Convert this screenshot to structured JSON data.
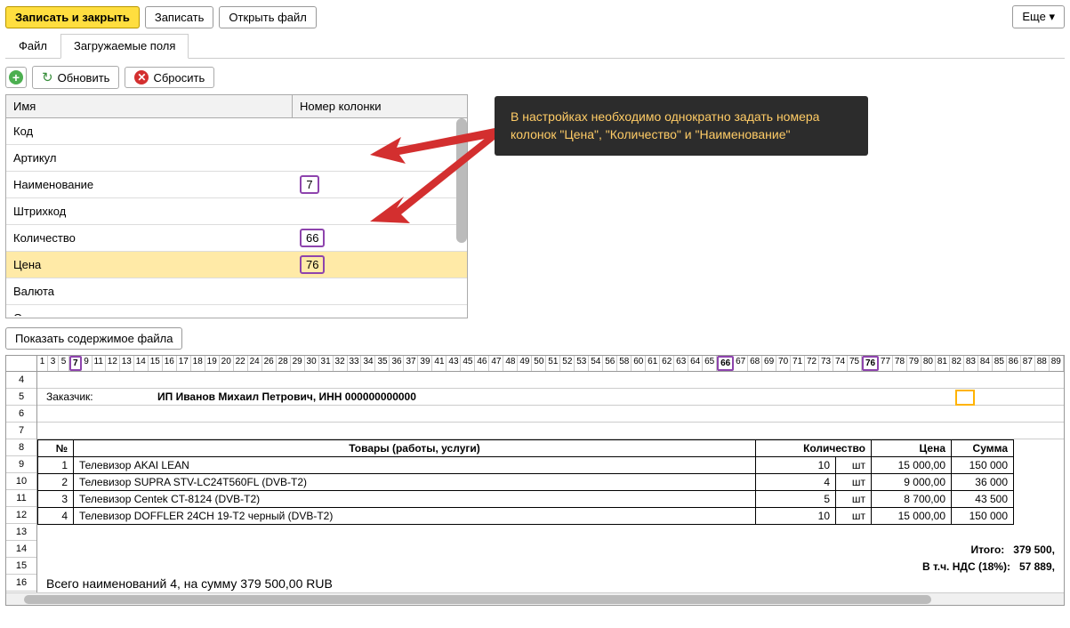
{
  "toolbar": {
    "save_close": "Записать и закрыть",
    "save": "Записать",
    "open_file": "Открыть файл",
    "more": "Еще"
  },
  "tabs": {
    "file": "Файл",
    "fields": "Загружаемые поля"
  },
  "subtoolbar": {
    "refresh": "Обновить",
    "reset": "Сбросить"
  },
  "fields_grid": {
    "header_name": "Имя",
    "header_col": "Номер колонки",
    "rows": [
      {
        "name": "Код",
        "col": ""
      },
      {
        "name": "Артикул",
        "col": ""
      },
      {
        "name": "Наименование",
        "col": "7"
      },
      {
        "name": "Штрихкод",
        "col": ""
      },
      {
        "name": "Количество",
        "col": "66"
      },
      {
        "name": "Цена",
        "col": "76",
        "selected": true
      },
      {
        "name": "Валюта",
        "col": ""
      },
      {
        "name": "Остаток",
        "col": ""
      }
    ]
  },
  "tooltip": "В настройках необходимо однократно задать номера колонок \"Цена\", \"Количество\" и \"Наименование\"",
  "show_file": "Показать содержимое файла",
  "ruler": [
    "1",
    "3",
    "5",
    "7",
    "9",
    "11",
    "12",
    "13",
    "14",
    "15",
    "16",
    "17",
    "18",
    "19",
    "20",
    "22",
    "24",
    "26",
    "28",
    "29",
    "30",
    "31",
    "32",
    "33",
    "34",
    "35",
    "36",
    "37",
    "39",
    "41",
    "43",
    "45",
    "46",
    "47",
    "48",
    "49",
    "50",
    "51",
    "52",
    "53",
    "54",
    "56",
    "58",
    "60",
    "61",
    "62",
    "63",
    "64",
    "65",
    "66",
    "67",
    "68",
    "69",
    "70",
    "71",
    "72",
    "73",
    "74",
    "75",
    "76",
    "77",
    "78",
    "79",
    "80",
    "81",
    "82",
    "83",
    "84",
    "85",
    "86",
    "87",
    "88",
    "89"
  ],
  "ruler_hl": [
    "7",
    "66",
    "76"
  ],
  "rownums": [
    "4",
    "5",
    "6",
    "7",
    "8",
    "9",
    "10",
    "11",
    "12",
    "13",
    "14",
    "15",
    "16"
  ],
  "customer": {
    "label": "Заказчик:",
    "value": "ИП Иванов Михаил Петрович, ИНН 000000000000"
  },
  "dtable": {
    "headers": {
      "num": "№",
      "name": "Товары (работы, услуги)",
      "qty": "Количество",
      "price": "Цена",
      "sum": "Сумма"
    },
    "rows": [
      {
        "n": "1",
        "name": "Телевизор AKAI LEAN",
        "qty": "10",
        "unit": "шт",
        "price": "15 000,00",
        "sum": "150 000"
      },
      {
        "n": "2",
        "name": "Телевизор SUPRA STV-LC24T560FL (DVB-T2)",
        "qty": "4",
        "unit": "шт",
        "price": "9 000,00",
        "sum": "36 000"
      },
      {
        "n": "3",
        "name": "Телевизор Centek CT-8124 (DVB-T2)",
        "qty": "5",
        "unit": "шт",
        "price": "8 700,00",
        "sum": "43 500"
      },
      {
        "n": "4",
        "name": "Телевизор DOFFLER 24CH 19-T2 черный (DVB-T2)",
        "qty": "10",
        "unit": "шт",
        "price": "15 000,00",
        "sum": "150 000"
      }
    ]
  },
  "totals": {
    "total_lbl": "Итого:",
    "total_val": "379 500,",
    "vat_lbl": "В т.ч. НДС (18%):",
    "vat_val": "57 889,"
  },
  "footer": "Всего наименований 4, на сумму 379 500,00 RUB"
}
